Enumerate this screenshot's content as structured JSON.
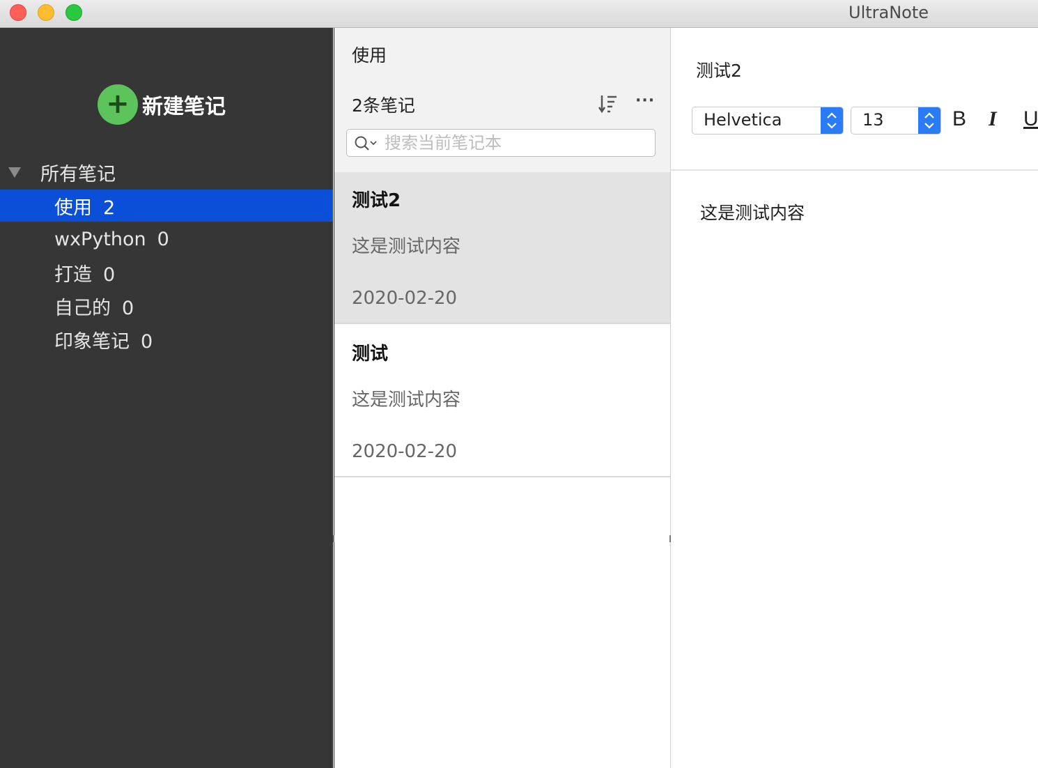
{
  "window": {
    "title": "UltraNote"
  },
  "sidebar": {
    "new_note_icon": "+",
    "new_note_label": "新建笔记",
    "root_label": "所有笔记",
    "notebooks": [
      {
        "name": "使用",
        "count": "2",
        "selected": true
      },
      {
        "name": "wxPython",
        "count": "0",
        "selected": false
      },
      {
        "name": "打造",
        "count": "0",
        "selected": false
      },
      {
        "name": "自己的",
        "count": "0",
        "selected": false
      },
      {
        "name": "印象笔记",
        "count": "0",
        "selected": false
      }
    ]
  },
  "note_list": {
    "notebook_title": "使用",
    "count_label": "2条笔记",
    "more_label": "···",
    "search": {
      "placeholder": "搜索当前笔记本",
      "value": ""
    },
    "notes": [
      {
        "title": "测试2",
        "snippet": "这是测试内容",
        "date": "2020-02-20",
        "selected": true
      },
      {
        "title": "测试",
        "snippet": "这是测试内容",
        "date": "2020-02-20",
        "selected": false
      }
    ]
  },
  "editor": {
    "title": "测试2",
    "font": "Helvetica",
    "size": "13",
    "bold_label": "B",
    "italic_label": "I",
    "underline_label": "U",
    "body": "这是测试内容"
  },
  "colors": {
    "sidebar_bg": "#363636",
    "selection": "#0b4fd8",
    "new_note_green": "#5cc45a",
    "stepper_blue": "#2a7cf6"
  }
}
